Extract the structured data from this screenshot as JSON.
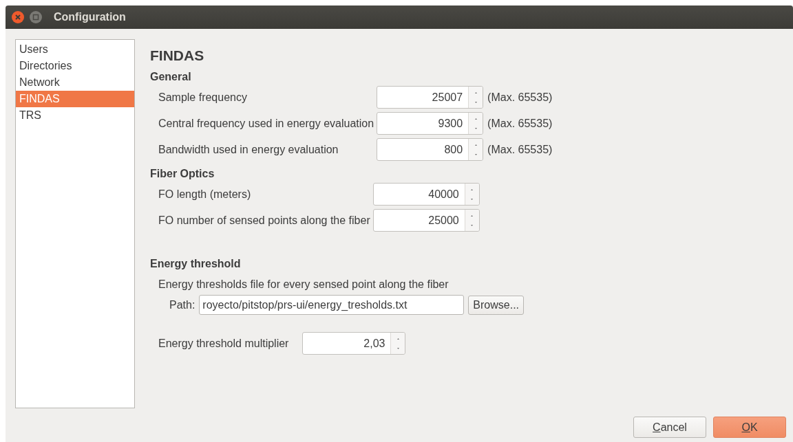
{
  "window": {
    "title": "Configuration"
  },
  "sidebar": {
    "items": [
      {
        "label": "Users",
        "selected": false
      },
      {
        "label": "Directories",
        "selected": false
      },
      {
        "label": "Network",
        "selected": false
      },
      {
        "label": "FINDAS",
        "selected": true
      },
      {
        "label": "TRS",
        "selected": false
      }
    ]
  },
  "page_title": "FINDAS",
  "sections": [
    {
      "title": "General",
      "rows": [
        {
          "label": "Sample frequency",
          "value": "25007",
          "hint": "(Max. 65535)"
        },
        {
          "label": "Central frequency used in energy evaluation",
          "value": "9300",
          "hint": "(Max. 65535)"
        },
        {
          "label": "Bandwidth used in energy evaluation",
          "value": "800",
          "hint": "(Max. 65535)"
        }
      ]
    },
    {
      "title": "Fiber Optics",
      "rows": [
        {
          "label": "FO length (meters)",
          "value": "40000"
        },
        {
          "label": "FO number of sensed points along the fiber",
          "value": "25000"
        }
      ]
    }
  ],
  "energy": {
    "title": "Energy threshold",
    "description": "Energy thresholds file for every sensed point along the fiber",
    "path_label": "Path:",
    "path_value": "royecto/pitstop/prs-ui/energy_tresholds.txt",
    "browse": "Browse...",
    "multiplier_label": "Energy threshold multiplier",
    "multiplier_value": "2,03"
  },
  "buttons": [
    {
      "label": "Cancel",
      "default": false
    },
    {
      "label": "OK",
      "default": true
    }
  ]
}
